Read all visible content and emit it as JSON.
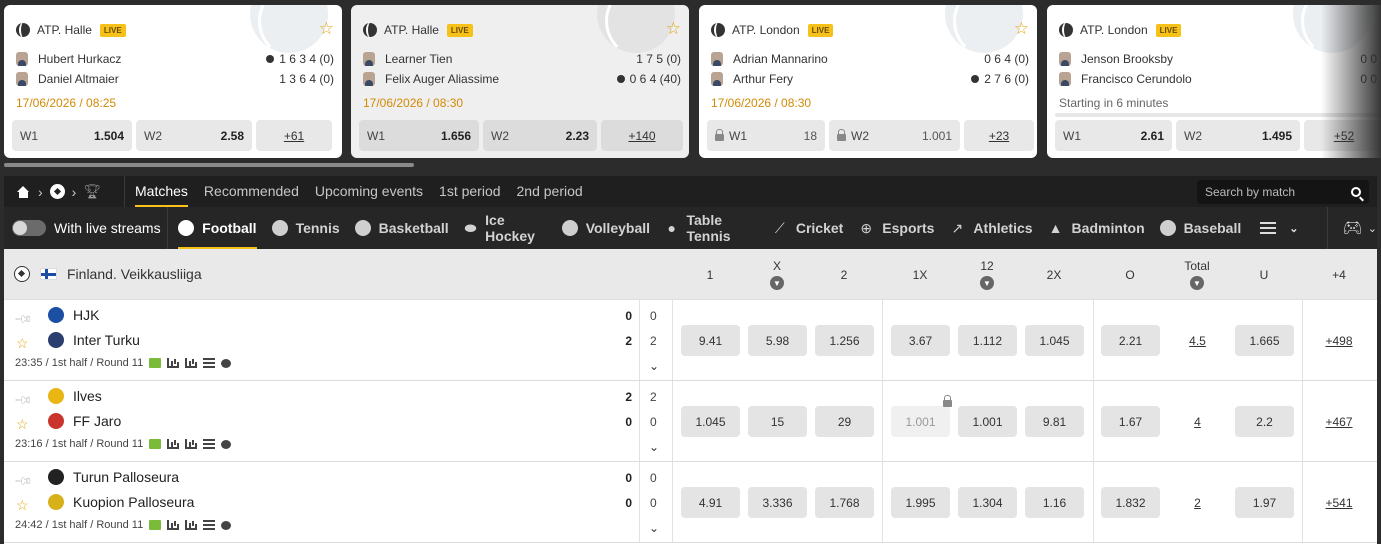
{
  "cards": [
    {
      "tournament": "ATP. Halle",
      "live": "LIVE",
      "players": [
        {
          "name": "Hubert Hurkacz",
          "serving": true,
          "score": "1 6 3 4 (0)"
        },
        {
          "name": "Daniel Altmaier",
          "serving": false,
          "score": "1 3 6 4 (0)"
        }
      ],
      "date": "17/06/2026 / 08:25",
      "odds": [
        {
          "label": "W1",
          "value": "1.504"
        },
        {
          "label": "W2",
          "value": "2.58"
        }
      ],
      "more": "+61"
    },
    {
      "tournament": "ATP. Halle",
      "live": "LIVE",
      "players": [
        {
          "name": "Learner Tien",
          "serving": false,
          "score": "1 7 5  (0)"
        },
        {
          "name": "Felix Auger Aliassime",
          "serving": true,
          "score": "0 6 4 (40)"
        }
      ],
      "date": "17/06/2026 / 08:30",
      "odds": [
        {
          "label": "W1",
          "value": "1.656"
        },
        {
          "label": "W2",
          "value": "2.23"
        }
      ],
      "more": "+140"
    },
    {
      "tournament": "ATP. London",
      "live": "LIVE",
      "players": [
        {
          "name": "Adrian Mannarino",
          "serving": false,
          "score": "0 6 4 (0)"
        },
        {
          "name": "Arthur Fery",
          "serving": true,
          "score": "2 7 6 (0)"
        }
      ],
      "date": "17/06/2026 / 08:30",
      "odds": [
        {
          "label": "W1",
          "value": "18"
        },
        {
          "label": "W2",
          "value": "1.001"
        }
      ],
      "more": "+23"
    },
    {
      "tournament": "ATP. London",
      "live": "LIVE",
      "players": [
        {
          "name": "Jenson Brooksby",
          "serving": false,
          "score": "0 0"
        },
        {
          "name": "Francisco Cerundolo",
          "serving": false,
          "score": "0 0"
        }
      ],
      "date": "Starting in 6 minutes",
      "odds": [
        {
          "label": "W1",
          "value": "2.61"
        },
        {
          "label": "W2",
          "value": "1.495"
        }
      ],
      "more": "+52"
    }
  ],
  "nav": {
    "tabs": [
      "Matches",
      "Recommended",
      "Upcoming events",
      "1st period",
      "2nd period"
    ],
    "search_placeholder": "Search by match"
  },
  "sportsbar": {
    "live_streams": "With live streams",
    "sports": [
      {
        "name": "Football",
        "icon": "football-icon"
      },
      {
        "name": "Tennis",
        "icon": "tennis-icon"
      },
      {
        "name": "Basketball",
        "icon": "basketball-icon"
      },
      {
        "name": "Ice Hockey",
        "icon": "ice-hockey-icon"
      },
      {
        "name": "Volleyball",
        "icon": "volleyball-icon"
      },
      {
        "name": "Table Tennis",
        "icon": "table-tennis-icon"
      },
      {
        "name": "Cricket",
        "icon": "cricket-icon"
      },
      {
        "name": "Esports",
        "icon": "esports-icon"
      },
      {
        "name": "Athletics",
        "icon": "athletics-icon"
      },
      {
        "name": "Badminton",
        "icon": "badminton-icon"
      },
      {
        "name": "Baseball",
        "icon": "baseball-icon"
      }
    ]
  },
  "league": {
    "name": "Finland. Veikkausliiga",
    "columns": [
      "1",
      "X",
      "2",
      "1X",
      "12",
      "2X",
      "O",
      "Total",
      "U",
      "+4"
    ]
  },
  "matches": [
    {
      "team1": "HJK",
      "team2": "Inter Turku",
      "score1": "0",
      "score2": "2",
      "half1": "0",
      "half2": "2",
      "meta": "23:35 / 1st half / Round 11",
      "odds": [
        "9.41",
        "5.98",
        "1.256",
        "3.67",
        "1.112",
        "1.045",
        "2.21",
        "4.5",
        "1.665"
      ],
      "more": "+498"
    },
    {
      "team1": "Ilves",
      "team2": "FF Jaro",
      "score1": "2",
      "score2": "0",
      "half1": "2",
      "half2": "0",
      "meta": "23:16 / 1st half / Round 11",
      "odds": [
        "1.045",
        "15",
        "29",
        "1.001",
        "1.001",
        "9.81",
        "1.67",
        "4",
        "2.2"
      ],
      "more": "+467"
    },
    {
      "team1": "Turun Palloseura",
      "team2": "Kuopion Palloseura",
      "score1": "0",
      "score2": "0",
      "half1": "0",
      "half2": "0",
      "meta": "24:42 / 1st half / Round 11",
      "odds": [
        "4.91",
        "3.336",
        "1.768",
        "1.995",
        "1.304",
        "1.16",
        "1.832",
        "2",
        "1.97"
      ],
      "more": "+541"
    }
  ]
}
